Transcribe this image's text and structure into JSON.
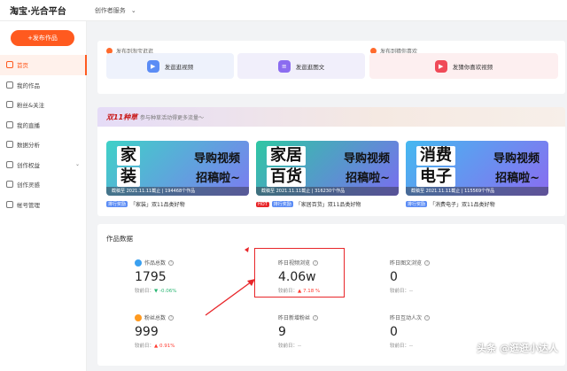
{
  "header": {
    "logo": "淘宝·光合平台",
    "service_menu": "创作者服务"
  },
  "sidebar": {
    "publish_label": "+发布作品",
    "items": [
      {
        "label": "首页",
        "active": true
      },
      {
        "label": "我的作品"
      },
      {
        "label": "粉丝&关注"
      },
      {
        "label": "我的直播"
      },
      {
        "label": "数据分析"
      },
      {
        "label": "创作权益",
        "expandable": true
      },
      {
        "label": "创作灵感"
      },
      {
        "label": "帐号管理"
      }
    ]
  },
  "publish": {
    "taobao_head": "发布到淘宝逛逛",
    "guess_head": "发布到猜你喜欢",
    "buttons": [
      "发逛逛视频",
      "发逛逛图文",
      "发猜你喜欢视频"
    ]
  },
  "campaign": {
    "logo": "双11种草",
    "desc": "参与种草活动得更多流量～",
    "cards": [
      {
        "big1": "家",
        "big2": "装",
        "slogan1": "导购视频",
        "slogan2": "招稿啦~",
        "strip": "截稿至 2021.11.11截止 | 194468个作品",
        "tag": "排行奖励",
        "caption": "「家装」双11品类好物"
      },
      {
        "big1": "家居",
        "big2": "百货",
        "slogan1": "导购视频",
        "slogan2": "招稿啦~",
        "strip": "截稿至 2021.11.11截止 | 316230个作品",
        "tag": "HOT",
        "tag2": "排行奖励",
        "caption": "「家居百货」双11品类好物"
      },
      {
        "big1": "消费",
        "big2": "电子",
        "slogan1": "导购视频",
        "slogan2": "招稿啦~",
        "strip": "截稿至 2021.11.11截止 | 115569个作品",
        "tag": "排行奖励",
        "caption": "「消费电子」双11品类好物"
      }
    ]
  },
  "works_data": {
    "title": "作品数据",
    "stats": [
      {
        "label": "作品总数",
        "value": "1795",
        "cmp": "较前日：",
        "delta": "▼ -0.06%",
        "dir": "down"
      },
      {
        "label": "昨日视频浏览",
        "value": "4.06w",
        "cmp": "较前日：",
        "delta": "▲ 7.18 %",
        "dir": "up"
      },
      {
        "label": "昨日图文浏览",
        "value": "0",
        "cmp": "较前日：--",
        "delta": "",
        "dir": ""
      },
      {
        "label": "粉丝总数",
        "value": "999",
        "cmp": "较前日：",
        "delta": "▲ 0.91%",
        "dir": "up"
      },
      {
        "label": "昨日新增粉丝",
        "value": "9",
        "cmp": "较前日：--",
        "delta": "",
        "dir": ""
      },
      {
        "label": "昨日互动人次",
        "value": "0",
        "cmp": "较前日：--",
        "delta": "",
        "dir": ""
      }
    ]
  },
  "watermark": "头条 @逛逛小达人"
}
